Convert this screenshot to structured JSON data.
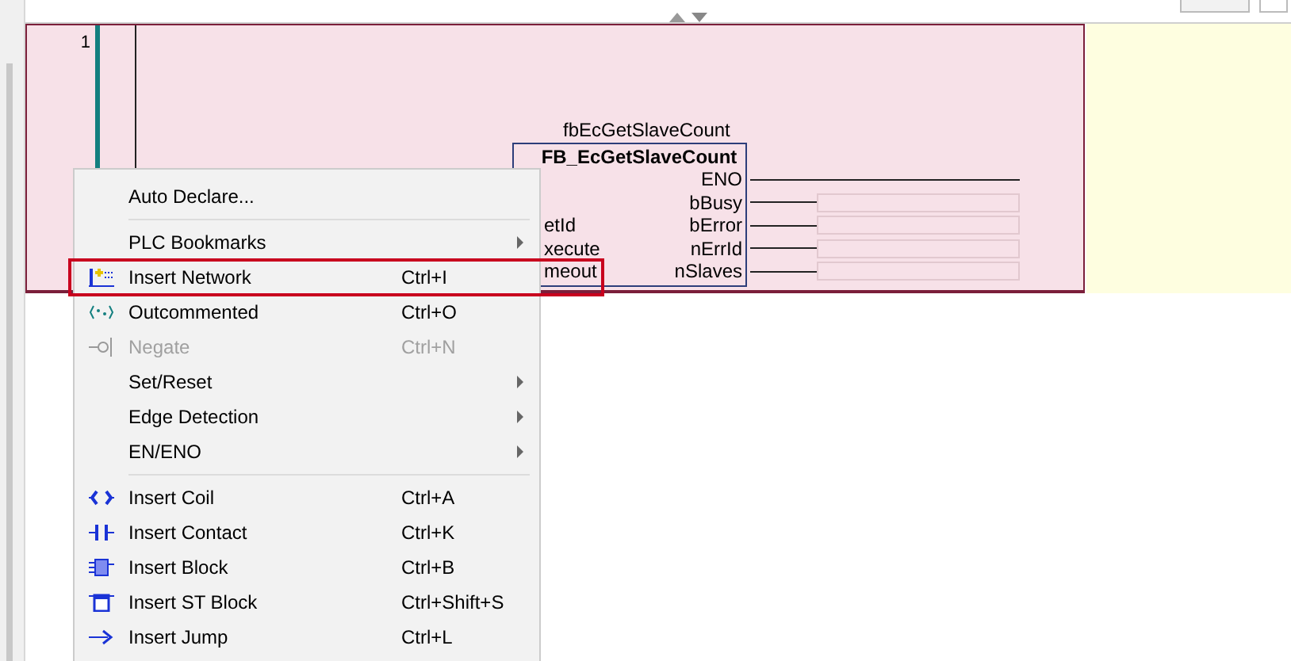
{
  "editor": {
    "network_number": "1"
  },
  "function_block": {
    "instance": "fbEcGetSlaveCount",
    "type": "FB_EcGetSlaveCount",
    "pins": [
      {
        "kind": "enable",
        "output": "ENO"
      },
      {
        "kind": "output",
        "output": "bBusy"
      },
      {
        "kind": "output",
        "input": "etId",
        "output": "bError"
      },
      {
        "kind": "output",
        "input": "xecute",
        "output": "nErrId"
      },
      {
        "kind": "output",
        "input": "meout",
        "output": "nSlaves"
      }
    ]
  },
  "context_menu": {
    "items": [
      {
        "kind": "item",
        "label": "Auto Declare...",
        "disabled": false,
        "submenu": false,
        "highlighted": false
      },
      {
        "kind": "separator"
      },
      {
        "kind": "item",
        "label": "PLC Bookmarks",
        "disabled": false,
        "submenu": true,
        "highlighted": false
      },
      {
        "kind": "item",
        "label": "Insert Network",
        "shortcut": "Ctrl+I",
        "disabled": false,
        "submenu": false,
        "highlighted": true
      },
      {
        "kind": "item",
        "label": "Outcommented",
        "shortcut": "Ctrl+O",
        "disabled": false,
        "submenu": false,
        "highlighted": false
      },
      {
        "kind": "item",
        "label": "Negate",
        "shortcut": "Ctrl+N",
        "disabled": true,
        "submenu": false,
        "highlighted": false
      },
      {
        "kind": "item",
        "label": "Set/Reset",
        "disabled": false,
        "submenu": true,
        "highlighted": false
      },
      {
        "kind": "item",
        "label": "Edge Detection",
        "disabled": false,
        "submenu": true,
        "highlighted": false
      },
      {
        "kind": "item",
        "label": "EN/ENO",
        "disabled": false,
        "submenu": true,
        "highlighted": false
      },
      {
        "kind": "separator"
      },
      {
        "kind": "item",
        "label": "Insert Coil",
        "shortcut": "Ctrl+A",
        "disabled": false,
        "submenu": false,
        "highlighted": false
      },
      {
        "kind": "item",
        "label": "Insert Contact",
        "shortcut": "Ctrl+K",
        "disabled": false,
        "submenu": false,
        "highlighted": false
      },
      {
        "kind": "item",
        "label": "Insert Block",
        "shortcut": "Ctrl+B",
        "disabled": false,
        "submenu": false,
        "highlighted": false
      },
      {
        "kind": "item",
        "label": "Insert ST Block",
        "shortcut": "Ctrl+Shift+S",
        "disabled": false,
        "submenu": false,
        "highlighted": false
      },
      {
        "kind": "item",
        "label": "Insert Jump",
        "shortcut": "Ctrl+L",
        "disabled": false,
        "submenu": false,
        "highlighted": false
      }
    ]
  }
}
